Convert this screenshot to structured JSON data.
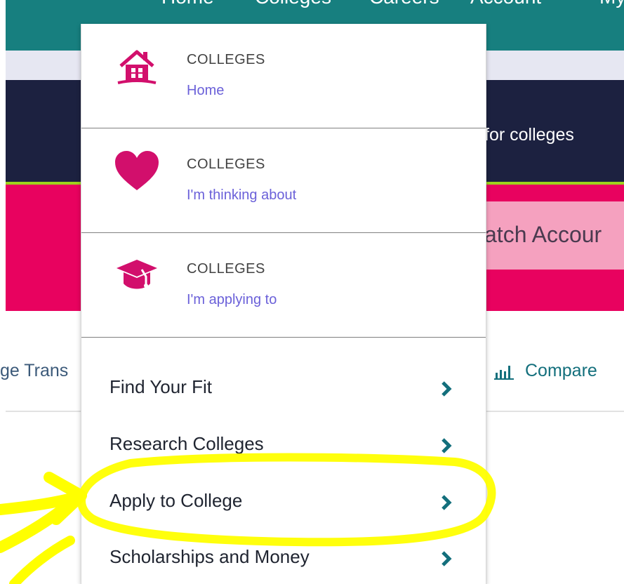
{
  "top_nav": {
    "links": [
      "Home",
      "Colleges",
      "Careers",
      "Account",
      "My"
    ]
  },
  "banner": {
    "navy_text": "for colleges",
    "pink_text": "atch Accour"
  },
  "page": {
    "left_text": "ge Trans",
    "compare_label": "Compare"
  },
  "dropdown": {
    "cards": [
      {
        "caption": "COLLEGES",
        "sub": "Home",
        "icon": "house-icon"
      },
      {
        "caption": "COLLEGES",
        "sub": "I'm thinking about",
        "icon": "heart-icon"
      },
      {
        "caption": "COLLEGES",
        "sub": "I'm applying to",
        "icon": "graduation-cap-icon"
      }
    ],
    "links": [
      {
        "label": "Find Your Fit"
      },
      {
        "label": "Research Colleges"
      },
      {
        "label": "Apply to College"
      },
      {
        "label": "Scholarships and Money"
      }
    ]
  },
  "colors": {
    "teal": "#177f7f",
    "navy": "#1c2140",
    "pink": "#e8025f",
    "accent_icon": "#d20f6c",
    "link_purple": "#6b61d9",
    "chevron": "#136f7c",
    "annotation": "#ffff00"
  }
}
